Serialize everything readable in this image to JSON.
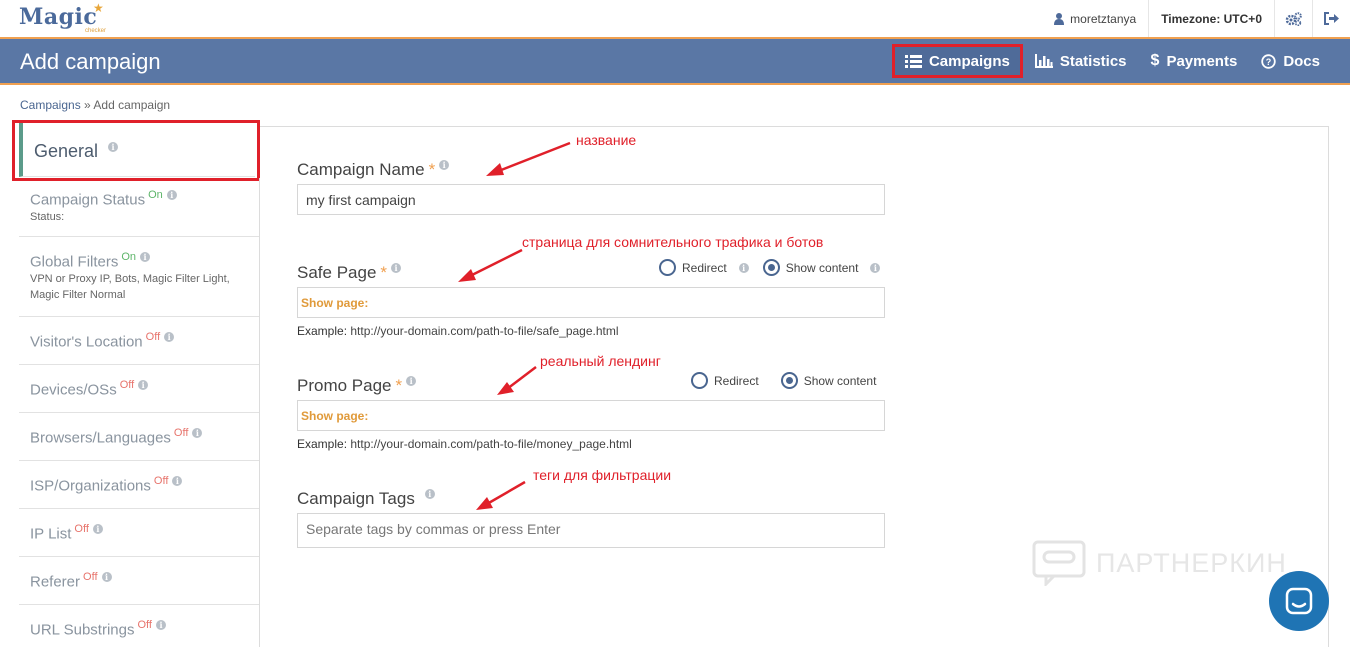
{
  "topbar": {
    "logo_text": "Magic",
    "logo_sub": "checker",
    "username": "moretztanya",
    "timezone": "Timezone: UTC+0",
    "icons": [
      "user-icon",
      "settings-icon",
      "logout-icon"
    ]
  },
  "header": {
    "title": "Add campaign",
    "nav": [
      {
        "label": "Campaigns",
        "icon": "list-icon",
        "active": true
      },
      {
        "label": "Statistics",
        "icon": "bar-chart-icon"
      },
      {
        "label": "Payments",
        "icon": "dollar-icon"
      },
      {
        "label": "Docs",
        "icon": "help-icon"
      }
    ]
  },
  "breadcrumb": {
    "link": "Campaigns",
    "separator": " » ",
    "current": "Add campaign"
  },
  "sidebar": {
    "general": "General",
    "items": [
      {
        "name": "Campaign Status",
        "state": "On",
        "desc": "Status:"
      },
      {
        "name": "Global Filters",
        "state": "On",
        "desc": "VPN or Proxy IP, Bots, Magic Filter Light, Magic Filter Normal"
      },
      {
        "name": "Visitor's Location",
        "state": "Off",
        "desc": ""
      },
      {
        "name": "Devices/OSs",
        "state": "Off",
        "desc": ""
      },
      {
        "name": "Browsers/Languages",
        "state": "Off",
        "desc": ""
      },
      {
        "name": "ISP/Organizations",
        "state": "Off",
        "desc": ""
      },
      {
        "name": "IP List",
        "state": "Off",
        "desc": ""
      },
      {
        "name": "Referer",
        "state": "Off",
        "desc": ""
      },
      {
        "name": "URL Substrings",
        "state": "Off",
        "desc": ""
      }
    ]
  },
  "form": {
    "campaign_name": {
      "label": "Campaign Name",
      "required": "*",
      "value": "my first campaign"
    },
    "safe_page": {
      "label": "Safe Page",
      "required": "*",
      "value": "Show page:",
      "example_prefix": "Example:",
      "example": "http://your-domain.com/path-to-file/safe_page.html",
      "radio_redirect": "Redirect",
      "radio_show": "Show content",
      "selected": "Show content"
    },
    "promo_page": {
      "label": "Promo Page",
      "required": "*",
      "value": "Show page:",
      "example_prefix": "Example:",
      "example": "http://your-domain.com/path-to-file/money_page.html",
      "radio_redirect": "Redirect",
      "radio_show": "Show content",
      "selected": "Show content"
    },
    "campaign_tags": {
      "label": "Campaign Tags",
      "placeholder": "Separate tags by commas or press Enter"
    }
  },
  "annotations": {
    "name": "название",
    "safe": "страница для сомнительного трафика и ботов",
    "promo": "реальный лендинг",
    "tags": "теги для фильтрации"
  },
  "watermark": "ПАРТНЕРКИН",
  "colors": {
    "header_bg": "#5a77a5",
    "accent_orange": "#f0a050",
    "highlight_red": "#e0202a",
    "on_green": "#5eb56a",
    "off_red": "#e7736b",
    "chat_blue": "#1f74b4"
  }
}
